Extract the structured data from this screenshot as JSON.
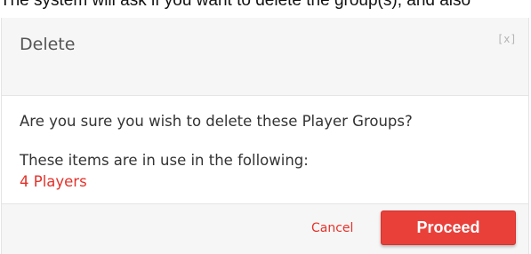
{
  "caption": {
    "text": "The system will ask if you want to delete the group(s), and also"
  },
  "dialog": {
    "title": "Delete",
    "close_label": "[x]",
    "question": "Are you sure you wish to delete these Player Groups?",
    "usage_label": "These items are in use in the following:",
    "usage_link": "4 Players",
    "cancel_label": "Cancel",
    "proceed_label": "Proceed"
  },
  "colors": {
    "accent": "#e9403a",
    "link": "#e4322b",
    "header_bg": "#f6f6f6"
  }
}
